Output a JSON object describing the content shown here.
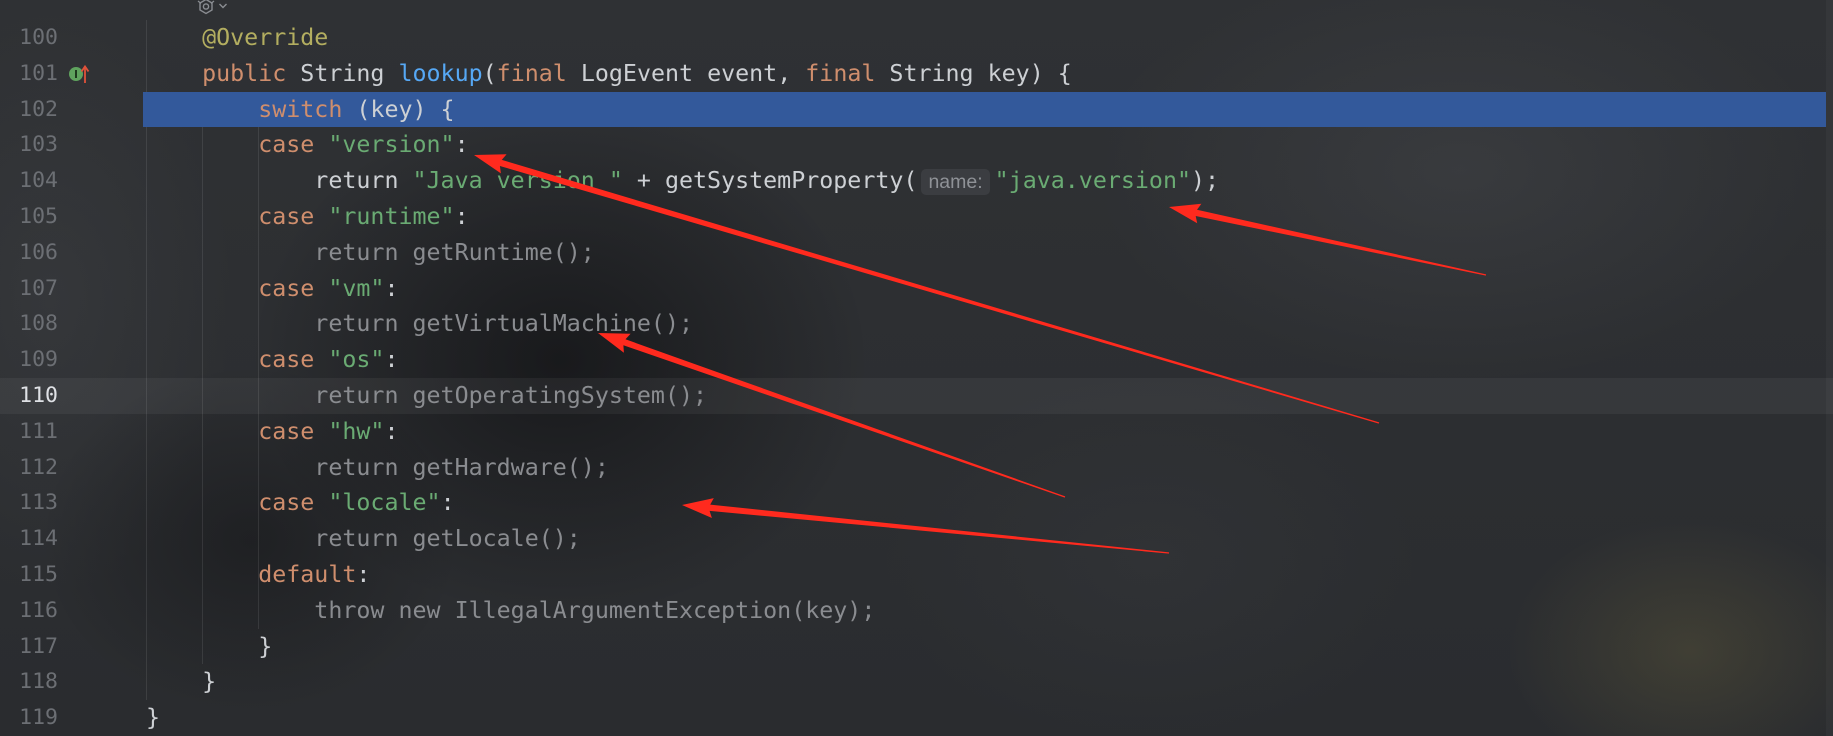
{
  "editor": {
    "selected_line": 102,
    "current_line": 110,
    "gutter_icon_line": 101,
    "gutter_icon": "implements-method-icon",
    "inlay_icon": "code-vision-icon",
    "inlay_chevron": "chevron-down-icon",
    "colors": {
      "selection": "#33599b",
      "line_number": "#6c6f74",
      "line_number_current": "#dfe1e5",
      "arrow": "#ff2a1e"
    }
  },
  "lines": [
    {
      "number": "100",
      "tokens": [
        {
          "text": "    @Override",
          "color": "#b3ae60"
        }
      ]
    },
    {
      "number": "101",
      "tokens": [
        {
          "text": "    public",
          "color": "#cf8e6d"
        },
        {
          "text": " String ",
          "color": "#cdd0d4"
        },
        {
          "text": "lookup",
          "color": "#56a8f5"
        },
        {
          "text": "(",
          "color": "#cdd0d4"
        },
        {
          "text": "final",
          "color": "#cf8e6d"
        },
        {
          "text": " LogEvent event, ",
          "color": "#cdd0d4"
        },
        {
          "text": "final",
          "color": "#cf8e6d"
        },
        {
          "text": " String key) {",
          "color": "#cdd0d4"
        }
      ]
    },
    {
      "number": "102",
      "tokens": [
        {
          "text": "        switch",
          "color": "#cf8e6d"
        },
        {
          "text": " (key) {",
          "color": "#cdd0d4"
        }
      ]
    },
    {
      "number": "103",
      "tokens": [
        {
          "text": "        case ",
          "color": "#cf8e6d"
        },
        {
          "text": "\"version\"",
          "color": "#6aab73"
        },
        {
          "text": ":",
          "color": "#cdd0d4"
        }
      ]
    },
    {
      "number": "104",
      "tokens": [
        {
          "text": "            return ",
          "color": "#cdd0d4"
        },
        {
          "text": "\"Java version \"",
          "color": "#6aab73"
        },
        {
          "text": " + getSystemProperty(",
          "color": "#cdd0d4"
        },
        {
          "hint": "name:"
        },
        {
          "text": "\"java.version\"",
          "color": "#6aab73"
        },
        {
          "text": ");",
          "color": "#cdd0d4"
        }
      ]
    },
    {
      "number": "105",
      "tokens": [
        {
          "text": "        case ",
          "color": "#cf8e6d"
        },
        {
          "text": "\"runtime\"",
          "color": "#6aab73"
        },
        {
          "text": ":",
          "color": "#cdd0d4"
        }
      ]
    },
    {
      "number": "106",
      "tokens": [
        {
          "text": "            return getRuntime();",
          "color": "#8a8c90"
        }
      ]
    },
    {
      "number": "107",
      "tokens": [
        {
          "text": "        case ",
          "color": "#cf8e6d"
        },
        {
          "text": "\"vm\"",
          "color": "#6aab73"
        },
        {
          "text": ":",
          "color": "#cdd0d4"
        }
      ]
    },
    {
      "number": "108",
      "tokens": [
        {
          "text": "            return getVirtualMachine();",
          "color": "#8a8c90"
        }
      ]
    },
    {
      "number": "109",
      "tokens": [
        {
          "text": "        case ",
          "color": "#cf8e6d"
        },
        {
          "text": "\"os\"",
          "color": "#6aab73"
        },
        {
          "text": ":",
          "color": "#cdd0d4"
        }
      ]
    },
    {
      "number": "110",
      "tokens": [
        {
          "text": "            return getOperatingSystem();",
          "color": "#8a8c90"
        }
      ]
    },
    {
      "number": "111",
      "tokens": [
        {
          "text": "        case ",
          "color": "#cf8e6d"
        },
        {
          "text": "\"hw\"",
          "color": "#6aab73"
        },
        {
          "text": ":",
          "color": "#cdd0d4"
        }
      ]
    },
    {
      "number": "112",
      "tokens": [
        {
          "text": "            return getHardware();",
          "color": "#8a8c90"
        }
      ]
    },
    {
      "number": "113",
      "tokens": [
        {
          "text": "        case ",
          "color": "#cf8e6d"
        },
        {
          "text": "\"locale\"",
          "color": "#6aab73"
        },
        {
          "text": ":",
          "color": "#cdd0d4"
        }
      ]
    },
    {
      "number": "114",
      "tokens": [
        {
          "text": "            return getLocale();",
          "color": "#8a8c90"
        }
      ]
    },
    {
      "number": "115",
      "tokens": [
        {
          "text": "        default",
          "color": "#cf8e6d"
        },
        {
          "text": ":",
          "color": "#cdd0d4"
        }
      ]
    },
    {
      "number": "116",
      "tokens": [
        {
          "text": "            throw new IllegalArgumentException(key);",
          "color": "#8a8c90"
        }
      ]
    },
    {
      "number": "117",
      "tokens": [
        {
          "text": "        }",
          "color": "#cdd0d4"
        }
      ]
    },
    {
      "number": "118",
      "tokens": [
        {
          "text": "    }",
          "color": "#cdd0d4"
        }
      ]
    },
    {
      "number": "119",
      "tokens": [
        {
          "text": "}",
          "color": "#cdd0d4"
        }
      ]
    }
  ]
}
